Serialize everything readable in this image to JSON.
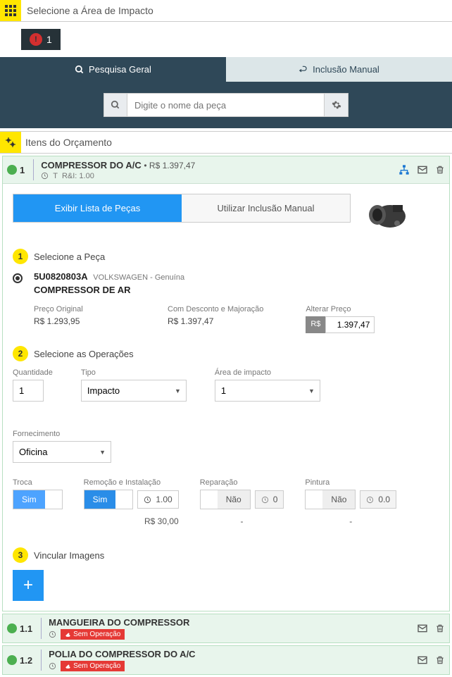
{
  "header": {
    "title": "Selecione a Área de Impacto"
  },
  "warning": {
    "count": "1"
  },
  "tabs": {
    "search": "Pesquisa Geral",
    "manual": "Inclusão Manual"
  },
  "search": {
    "placeholder": "Digite o nome da peça"
  },
  "section": {
    "title": "Itens do Orçamento"
  },
  "item1": {
    "num": "1",
    "title": "COMPRESSOR DO A/C",
    "price_inline": "• R$ 1.397,47",
    "sub_t": "T",
    "sub_ri": "R&I: 1.00",
    "mode_list": "Exibir Lista de Peças",
    "mode_manual": "Utilizar Inclusão Manual",
    "step1": "Selecione a Peça",
    "part_code": "5U0820803A",
    "part_brand": "VOLKSWAGEN - Genuína",
    "part_name": "COMPRESSOR DE AR",
    "price_orig_label": "Preço Original",
    "price_orig": "R$ 1.293,95",
    "price_disc_label": "Com Desconto e Majoração",
    "price_disc": "R$ 1.397,47",
    "price_alt_label": "Alterar Preço",
    "price_alt_prefix": "R$",
    "price_alt_val": "1.397,47",
    "step2": "Selecione as Operações",
    "qty_label": "Quantidade",
    "qty_val": "1",
    "tipo_label": "Tipo",
    "tipo_val": "Impacto",
    "area_label": "Área de impacto",
    "area_val": "1",
    "forn_label": "Fornecimento",
    "forn_val": "Oficina",
    "troca_label": "Troca",
    "troca_yes": "Sim",
    "rem_label": "Remoção e Instalação",
    "rem_yes": "Sim",
    "rem_time": "1.00",
    "rem_cost": "R$ 30,00",
    "rep_label": "Reparação",
    "rep_no": "Não",
    "rep_time": "0",
    "rep_cost": "-",
    "pin_label": "Pintura",
    "pin_no": "Não",
    "pin_time": "0.0",
    "pin_cost": "-",
    "step3": "Vincular Imagens"
  },
  "item11": {
    "num": "1.1",
    "title": "MANGUEIRA DO COMPRESSOR",
    "badge": "Sem Operação"
  },
  "item12": {
    "num": "1.2",
    "title": "POLIA DO COMPRESSOR DO A/C",
    "badge": "Sem Operação"
  }
}
